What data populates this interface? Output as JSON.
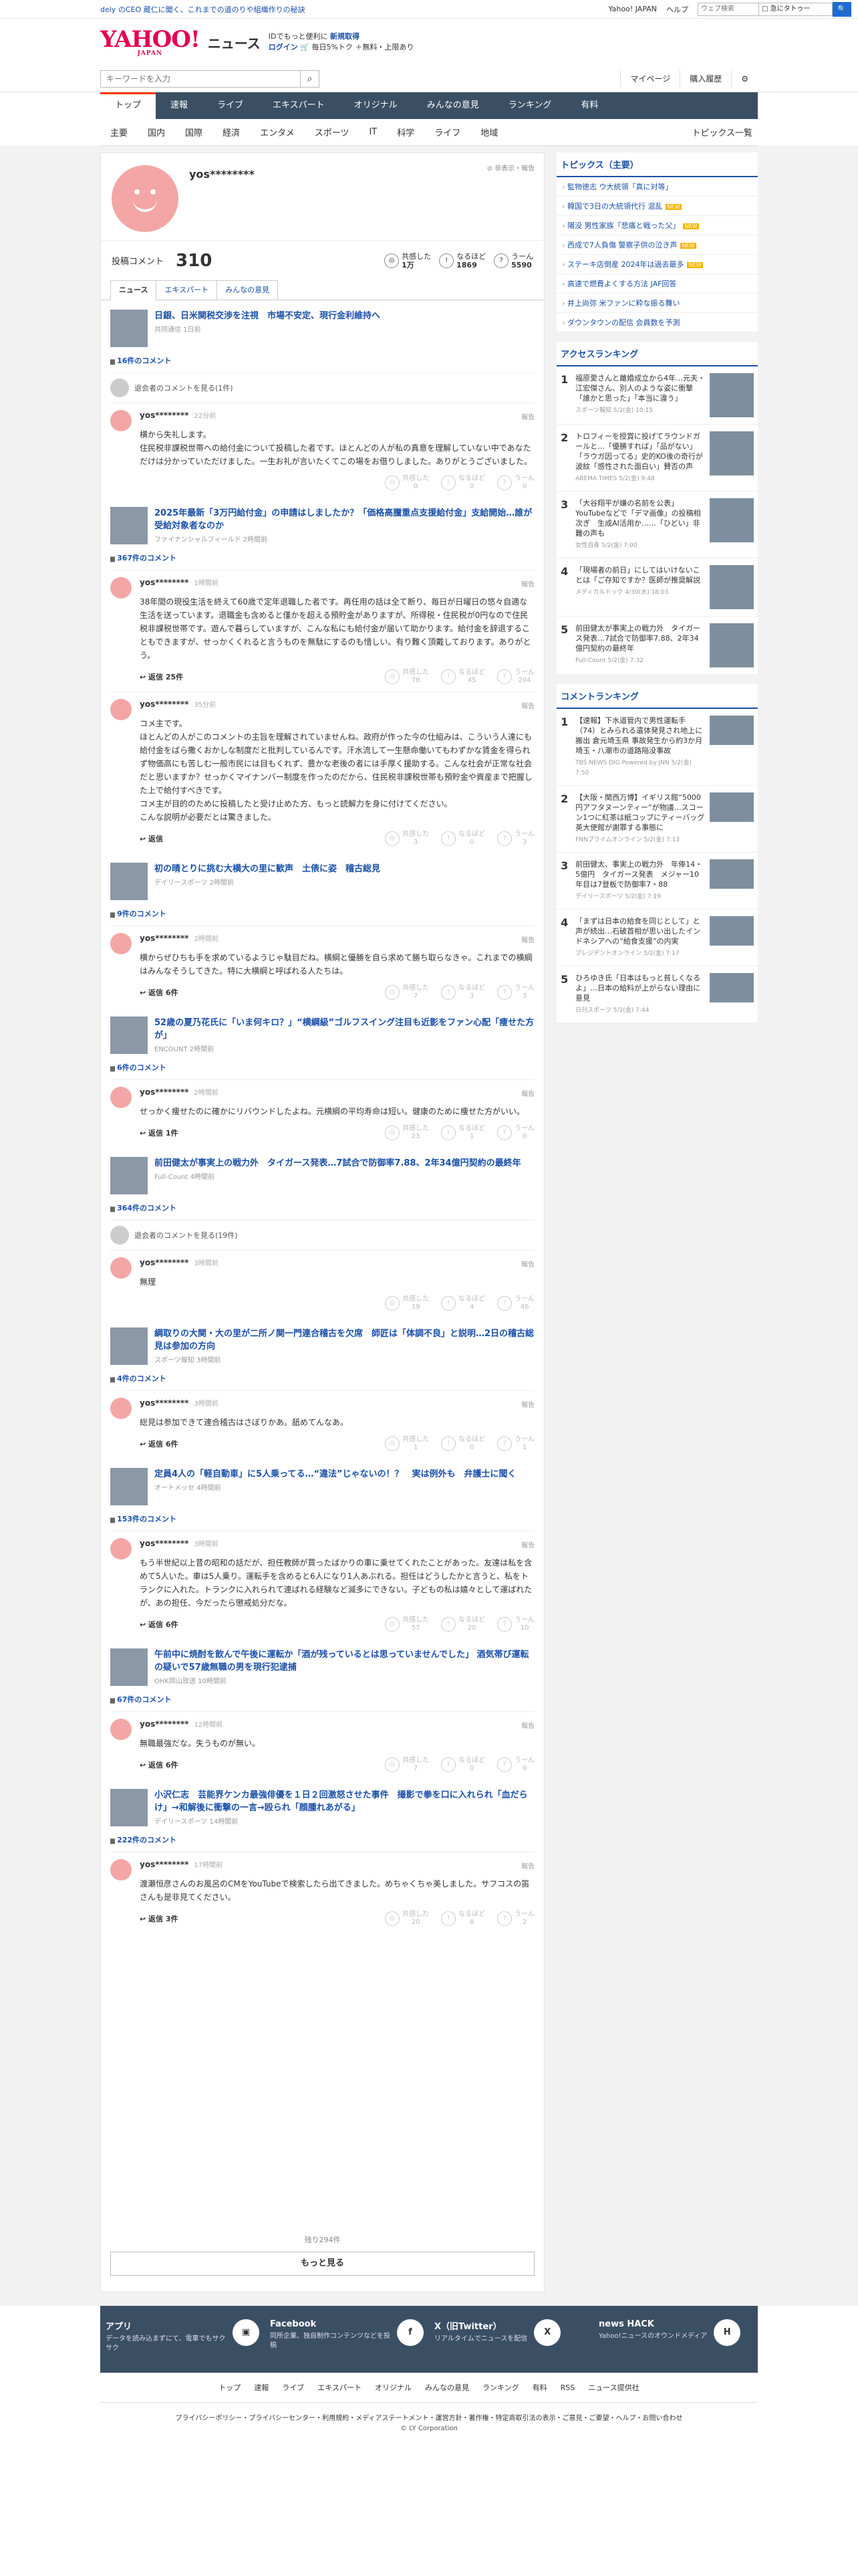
{
  "top": {
    "promo": "dely のCEO 蔵仁に聞く、これまでの道のりや組織作りの秘訣",
    "links": [
      "Yahoo! JAPAN",
      "ヘルプ"
    ],
    "search_placeholder": "ウェブ検索",
    "search_option": "□ 急にタトゥー",
    "go": "🔍"
  },
  "brand": {
    "logo": "YAHOO!",
    "logo_sub": "JAPAN",
    "news": "ニュース",
    "tag1": "IDでもっと便利に",
    "tag1b": "新規取得",
    "login": "ログイン",
    "tag2": "🛒 毎日5%トク ＋無料・上限あり"
  },
  "tools": {
    "search_placeholder": "キーワードを入力",
    "mypage": "マイページ",
    "history": "購入履歴",
    "gear": "⚙"
  },
  "gnav": [
    "トップ",
    "速報",
    "ライブ",
    "エキスパート",
    "オリジナル",
    "みんなの意見",
    "ランキング",
    "有料"
  ],
  "snav": [
    "主要",
    "国内",
    "国際",
    "経済",
    "エンタメ",
    "スポーツ",
    "IT",
    "科学",
    "ライフ",
    "地域"
  ],
  "snav_right": "トピックス一覧",
  "profile": {
    "name": "yos********",
    "hide": "⊘ 非表示・報告",
    "label": "投稿コメント",
    "count": "310",
    "r1": "共感した",
    "r1v": "1万",
    "r2": "なるほど",
    "r2v": "1869",
    "r3": "うーん",
    "r3v": "5590"
  },
  "tabs": [
    "ニュース",
    "エキスパート",
    "みんなの意見"
  ],
  "articles": [
    {
      "title": "日銀、日米関税交渉を注視　市場不安定、現行金利維持へ",
      "src": "共同通信 1日前",
      "count": "16件のコメント",
      "hidden": "退会者のコメントを見る(1件)",
      "comments": [
        {
          "user": "yos********",
          "time": "22分前",
          "body": "横から失礼します。\n住民税非課税世帯への給付金について投稿した者です。ほとんどの人が私の真意を理解していない中であなただけは分かっていただけました。一生お礼が言いたくてこの場をお借りしました。ありがとうございました。",
          "reply": "",
          "v": [
            "0",
            "0",
            "0"
          ]
        }
      ]
    },
    {
      "title": "2025年最新「3万円給付金」の申請はしましたか？「価格高騰重点支援給付金」支給開始…誰が受給対象者なのか",
      "src": "ファイナンシャルフィールド 2時間前",
      "count": "367件のコメント",
      "comments": [
        {
          "user": "yos********",
          "time": "1時間前",
          "body": "38年間の現役生活を終えて60歳で定年退職した者です。再任用の話は全て断り、毎日が日曜日の悠々自適な生活を送っています。退職金も含めると僅かを超える預貯金がありますが、所得税・住民税が0円なので住民税非課税世帯です。遊んで暮らしていますが、こんな私にも給付金が届いて助かります。給付金を辞退することもできますが、せっかくくれると言うものを無駄にするのも惜しい。有り難く頂戴しております。ありがとう。",
          "reply": "返信 25件",
          "v": [
            "78",
            "45",
            "204"
          ]
        },
        {
          "user": "yos********",
          "time": "35分前",
          "body": "コメ主です。\nほとんどの人がこのコメントの主旨を理解されていませんね。政府が作った今の仕組みは、こういう人達にも給付金をばら撒くおかしな制度だと批判しているんです。汗水流して一生懸命働いてもわずかな賃金を得られず物価高にも苦しむ一般市民には目もくれず、豊かな老後の者には手厚く援助する。こんな社会が正常な社会だと思いますか？せっかくマイナンバー制度を作ったのだから、住民税非課税世帯も預貯金や資産まで把握した上で給付すべきです。\nコメ主が目的のために投稿したと受け止めた方、もっと読解力を身に付けてください。\nこんな説明が必要だとは驚きました。",
          "reply": "返信",
          "v": [
            "3",
            "0",
            "3"
          ]
        }
      ]
    },
    {
      "title": "初の晴とりに挑む大横大の里に歓声　土俵に姿　稽古総見",
      "src": "デイリースポーツ 2時間前",
      "count": "9件のコメント",
      "comments": [
        {
          "user": "yos********",
          "time": "2時間前",
          "body": "横からぜひちも手を求めているようじゃ駄目だね。横綱と優勝を自ら求めて勝ち取らなきゃ。これまでの横綱はみんなそうしてきた。特に大横綱と呼ばれる人たちは。",
          "reply": "返信 6件",
          "v": [
            "7",
            "3",
            "3"
          ]
        }
      ]
    },
    {
      "title": "52歳の夏乃花氏に「いま何キロ？」“横綱級”ゴルフスイング注目も近影をファン心配「痩せた方が」",
      "src": "ENCOUNT 2時間前",
      "count": "6件のコメント",
      "comments": [
        {
          "user": "yos********",
          "time": "2時間前",
          "body": "せっかく痩せたのに確かにリバウンドしたよね。元横綱の平均寿命は短い。健康のために痩せた方がいい。",
          "reply": "返信 1件",
          "v": [
            "23",
            "1",
            "0"
          ]
        }
      ]
    },
    {
      "title": "前田健太が事実上の戦力外　タイガース発表…7試合で防御率7.88、2年34億円契約の最終年",
      "src": "Full-Count 4時間前",
      "count": "364件のコメント",
      "hidden": "退会者のコメントを見る(19件)",
      "comments": [
        {
          "user": "yos********",
          "time": "3時間前",
          "body": "無理",
          "reply": "",
          "v": [
            "19",
            "4",
            "46"
          ]
        }
      ]
    },
    {
      "title": "綱取りの大関・大の里が二所ノ関一門連合稽古を欠席　師匠は「体調不良」と説明…2日の稽古総見は参加の方向",
      "src": "スポーツ報知 3時間前",
      "count": "4件のコメント",
      "comments": [
        {
          "user": "yos********",
          "time": "3時間前",
          "body": "総見は参加できて連合稽古はさぼりかあ。舐めてんなあ。",
          "reply": "返信 6件",
          "v": [
            "1",
            "0",
            "1"
          ]
        }
      ]
    },
    {
      "title": "定員4人の「軽自動車」に5人乗ってる…“違法”じゃないの！？　実は例外も　弁護士に聞く",
      "src": "オートメッセ 4時間前",
      "count": "153件のコメント",
      "comments": [
        {
          "user": "yos********",
          "time": "3時間前",
          "body": "もう半世紀以上昔の昭和の話だが、担任教師が買ったばかりの車に乗せてくれたことがあった。友達は私を含めて5人いた。車は5人乗り。運転手を含めると6人になり1人あぶれる。担任はどうしたかと言うと、私をトランクに入れた。トランクに入れられて連ばれる経験など滅多にできない。子どもの私は嬉々として運ばれたが、あの担任、今だったら懲戒処分だな。",
          "reply": "返信 6件",
          "v": [
            "57",
            "20",
            "10"
          ]
        }
      ]
    },
    {
      "title": "午前中に焼酎を飲んで午後に運転か「酒が残っているとは思っていませんでした」 酒気帯び運転の疑いで57歳無職の男を現行犯逮捕",
      "src": "OHK岡山放送 10時間前",
      "count": "67件のコメント",
      "comments": [
        {
          "user": "yos********",
          "time": "12時間前",
          "body": "無職最強だな。失うものが無い。",
          "reply": "返信 6件",
          "v": [
            "7",
            "0",
            "0"
          ]
        }
      ]
    },
    {
      "title": "小沢仁志　芸能界ケンカ最強俳優を１日２回激怒させた事件　撮影で拳を口に入れられ「血だらけ」→和解後に衝撃の一言→殴られ「顔腫れあがる」",
      "src": "デイリースポーツ 14時間前",
      "count": "222件のコメント",
      "comments": [
        {
          "user": "yos********",
          "time": "17時間前",
          "body": "渡瀬恒彦さんのお風呂のCMをYouTubeで検索したら出てきました。めちゃくちゃ美しました。サフコスの笛さんも是非見てください。",
          "reply": "返信 3件",
          "v": [
            "20",
            "8",
            "2"
          ]
        }
      ]
    }
  ],
  "more": {
    "remaining": "残り294件",
    "button": "もっと見る"
  },
  "vote_labels": [
    "共感した",
    "なるほど",
    "うーん"
  ],
  "report": "報告",
  "topics": {
    "title": "トピックス（主要）",
    "items": [
      {
        "t": "監物徳志 ウ大統領「真に対等」",
        "n": false
      },
      {
        "t": "韓国で3日の大統領代行 混乱",
        "n": true
      },
      {
        "t": "陽没 男性家族「悲痛と戦った父」",
        "n": true
      },
      {
        "t": "西成で7人負傷 警察子供の泣き声",
        "n": true
      },
      {
        "t": "ステーキ店倒産 2024年は過去最多",
        "n": true
      },
      {
        "t": "高速で燃費よくする方法 JAF回答",
        "n": false
      },
      {
        "t": "井上尚弥 米ファンに粋な振る舞い",
        "n": false
      },
      {
        "t": "ダウンタウンの配信 会員数を予測",
        "n": false
      }
    ]
  },
  "access": {
    "title": "アクセスランキング",
    "items": [
      {
        "t": "福原愛さんと離婚成立から4年…元夫・江宏傑さん、別人のような姿に衝撃「誰かと思った」「本当に違う」",
        "s": "スポーツ報知 5/2(金) 10:15"
      },
      {
        "t": "トロフィーを授賞に投げてラウンドガールと…「優勝すれば」「品がない」「ラウガ因ってる」史的KO後の奇行が波紋「感性された面白い」賛否の声",
        "s": "ABEMA TIMES 5/2(金) 9:48"
      },
      {
        "t": "「大谷翔平が嫌の名前を公表」YouTubeなどで「デマ画像」の投稿相次ぎ　生成AI活用か……「ひどい」非難の声も",
        "s": "女性自身 5/2(金) 7:00"
      },
      {
        "t": "「現場者の前日」にしてはいけないことは「ご存知ですか？医師が推奨解説",
        "s": "メディカルドック 4/30(水) 18:03"
      },
      {
        "t": "前田健太が事実上の戦力外　タイガース発表…7試合で防御率7.88、2年34億円契約の最終年",
        "s": "Full-Count 5/2(金) 7:32"
      }
    ]
  },
  "cranking": {
    "title": "コメントランキング",
    "items": [
      {
        "t": "【速報】下水道管内で男性運転手（74）とみられる遺体発見され地上に搬出 倉元埼玉県 事故発生から約3か月 埼玉・八潮市の道路陥没事故",
        "s": "TBS NEWS DIG Powered by JNN 5/2(金) 7:50"
      },
      {
        "t": "【大阪・関西万博】イギリス館“5000円アフタヌーンティー”が物議…スコーン1つに紅茶は紙コップにティーバッグ　英大使館が謝罪する事態に",
        "s": "FNNプライムオンライン 5/2(金) 7:13"
      },
      {
        "t": "前田健太、事実上の戦力外　年俸14・5億円　タイガース発表　メジャー10年目は7登板で防御率7・88",
        "s": "デイリースポーツ 5/2(金) 7:19"
      },
      {
        "t": "「まずは日本の給食を同じとして」と声が続出…石破首相が思い出したインドネシアへの“給食支援”の内実",
        "s": "プレジデントオンライン 5/2(金) 7:17"
      },
      {
        "t": "ひろゆき氏「日本はもっと貧しくなるよ」…日本の給料が上がらない理由に意見",
        "s": "日刊スポーツ 5/2(金) 7:44"
      }
    ]
  },
  "footer": [
    {
      "h": "アプリ",
      "p": "データを読み込まずにて、電車でもサクサク",
      "ic": "▣"
    },
    {
      "h": "Facebook",
      "p": "同所企業、独自制作コンテンツなどを投稿",
      "ic": "f"
    },
    {
      "h": "X（旧Twitter）",
      "p": "リアルタイムでニュースを配信",
      "ic": "X"
    },
    {
      "h": "news HACK",
      "p": "Yahoo!ニュースのオウンドメディア",
      "ic": "H"
    }
  ],
  "flinks": [
    "トップ",
    "速報",
    "ライブ",
    "エキスパート",
    "オリジナル",
    "みんなの意見",
    "ランキング",
    "有料",
    "RSS",
    "ニュース提供社"
  ],
  "legal": "プライバシーポリシー・プライバシーセンター・利用規約・メディアステートメント・運営方針・著作権・特定商取引法の表示・ご意見・ご要望・ヘルプ・お問い合わせ",
  "copyright": "© LY Corporation"
}
